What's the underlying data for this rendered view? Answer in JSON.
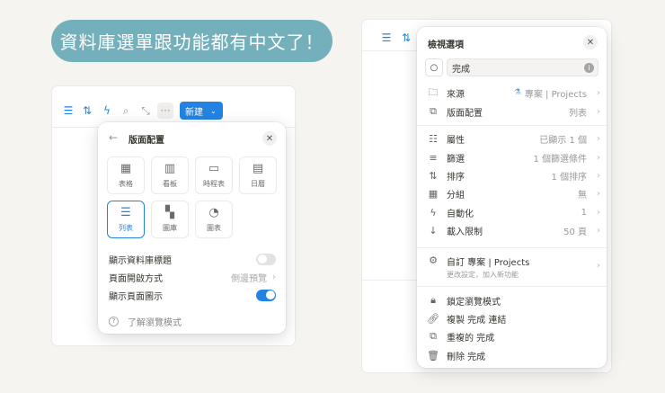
{
  "banner": "資料庫選單跟功能都有中文了！",
  "left": {
    "toolbar": {
      "new_label": "新建"
    },
    "popup": {
      "title": "版面配置",
      "layouts": [
        {
          "label": "表格",
          "icon": "table-icon"
        },
        {
          "label": "看板",
          "icon": "board-icon"
        },
        {
          "label": "時程表",
          "icon": "timeline-icon"
        },
        {
          "label": "日曆",
          "icon": "calendar-icon"
        },
        {
          "label": "列表",
          "icon": "list-icon",
          "selected": true
        },
        {
          "label": "圖庫",
          "icon": "gallery-icon"
        },
        {
          "label": "圖表",
          "icon": "chart-icon"
        }
      ],
      "show_db_title": {
        "label": "顯示資料庫標題",
        "on": false
      },
      "open_page": {
        "label": "頁面開啟方式",
        "value": "側邊預覽"
      },
      "show_page_icon": {
        "label": "顯示頁面圖示",
        "on": true
      },
      "learn": "了解瀏覽模式"
    }
  },
  "right": {
    "popup": {
      "title": "檢視選項",
      "view_name": "完成",
      "rows": [
        {
          "label": "來源",
          "value": "專案 | Projects"
        },
        {
          "label": "版面配置",
          "value": "列表"
        },
        {
          "label": "屬性",
          "value": "已顯示 1 個"
        },
        {
          "label": "篩選",
          "value": "1 個篩選條件"
        },
        {
          "label": "排序",
          "value": "1 個排序"
        },
        {
          "label": "分組",
          "value": "無"
        },
        {
          "label": "自動化",
          "value": "1"
        },
        {
          "label": "載入限制",
          "value": "50 頁"
        }
      ],
      "customize": {
        "title": "自訂 專案 | Projects",
        "subtitle": "更改設定，加入新功能"
      },
      "actions": [
        "鎖定瀏覽模式",
        "複製 完成 連結",
        "重複的 完成",
        "刪除 完成"
      ]
    }
  }
}
